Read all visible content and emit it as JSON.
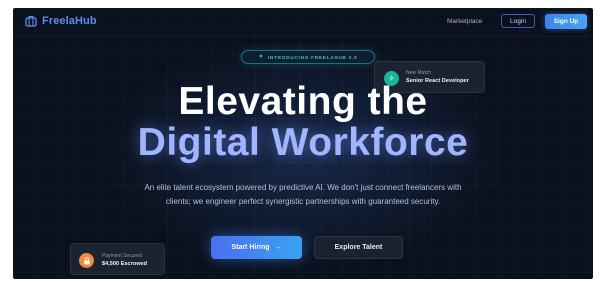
{
  "brand": {
    "name": "FreelaHub",
    "icon": "briefcase-icon",
    "color": "#5d8cf0"
  },
  "nav": {
    "links": [
      {
        "label": "Marketplace"
      }
    ],
    "login_label": "Login",
    "signup_label": "Sign Up"
  },
  "hero": {
    "badge_icon": "sparkle-icon",
    "badge": "INTRODUCING FREELAHUB 2.0",
    "title_line1": "Elevating the",
    "title_line2": "Digital Workforce",
    "description": "An elite talent ecosystem powered by predictive AI. We don't just connect freelancers with clients; we engineer perfect synergistic partnerships with guaranteed security.",
    "primary_cta": "Start Hiring",
    "primary_cta_arrow": "→",
    "secondary_cta": "Explore Talent"
  },
  "cards": {
    "match": {
      "label": "New Match",
      "value": "Senior React Developer",
      "icon": "sparkle-icon",
      "color": "#16b79a"
    },
    "payment": {
      "label": "Payment Secured",
      "value": "$4,500 Escrowed",
      "icon": "lock-icon",
      "color": "#f08a3c"
    }
  },
  "colors": {
    "background": "#0a101c",
    "accent": "#3c82ee",
    "heading_accent": "#9fb6ff",
    "badge": "#36c6d3"
  }
}
